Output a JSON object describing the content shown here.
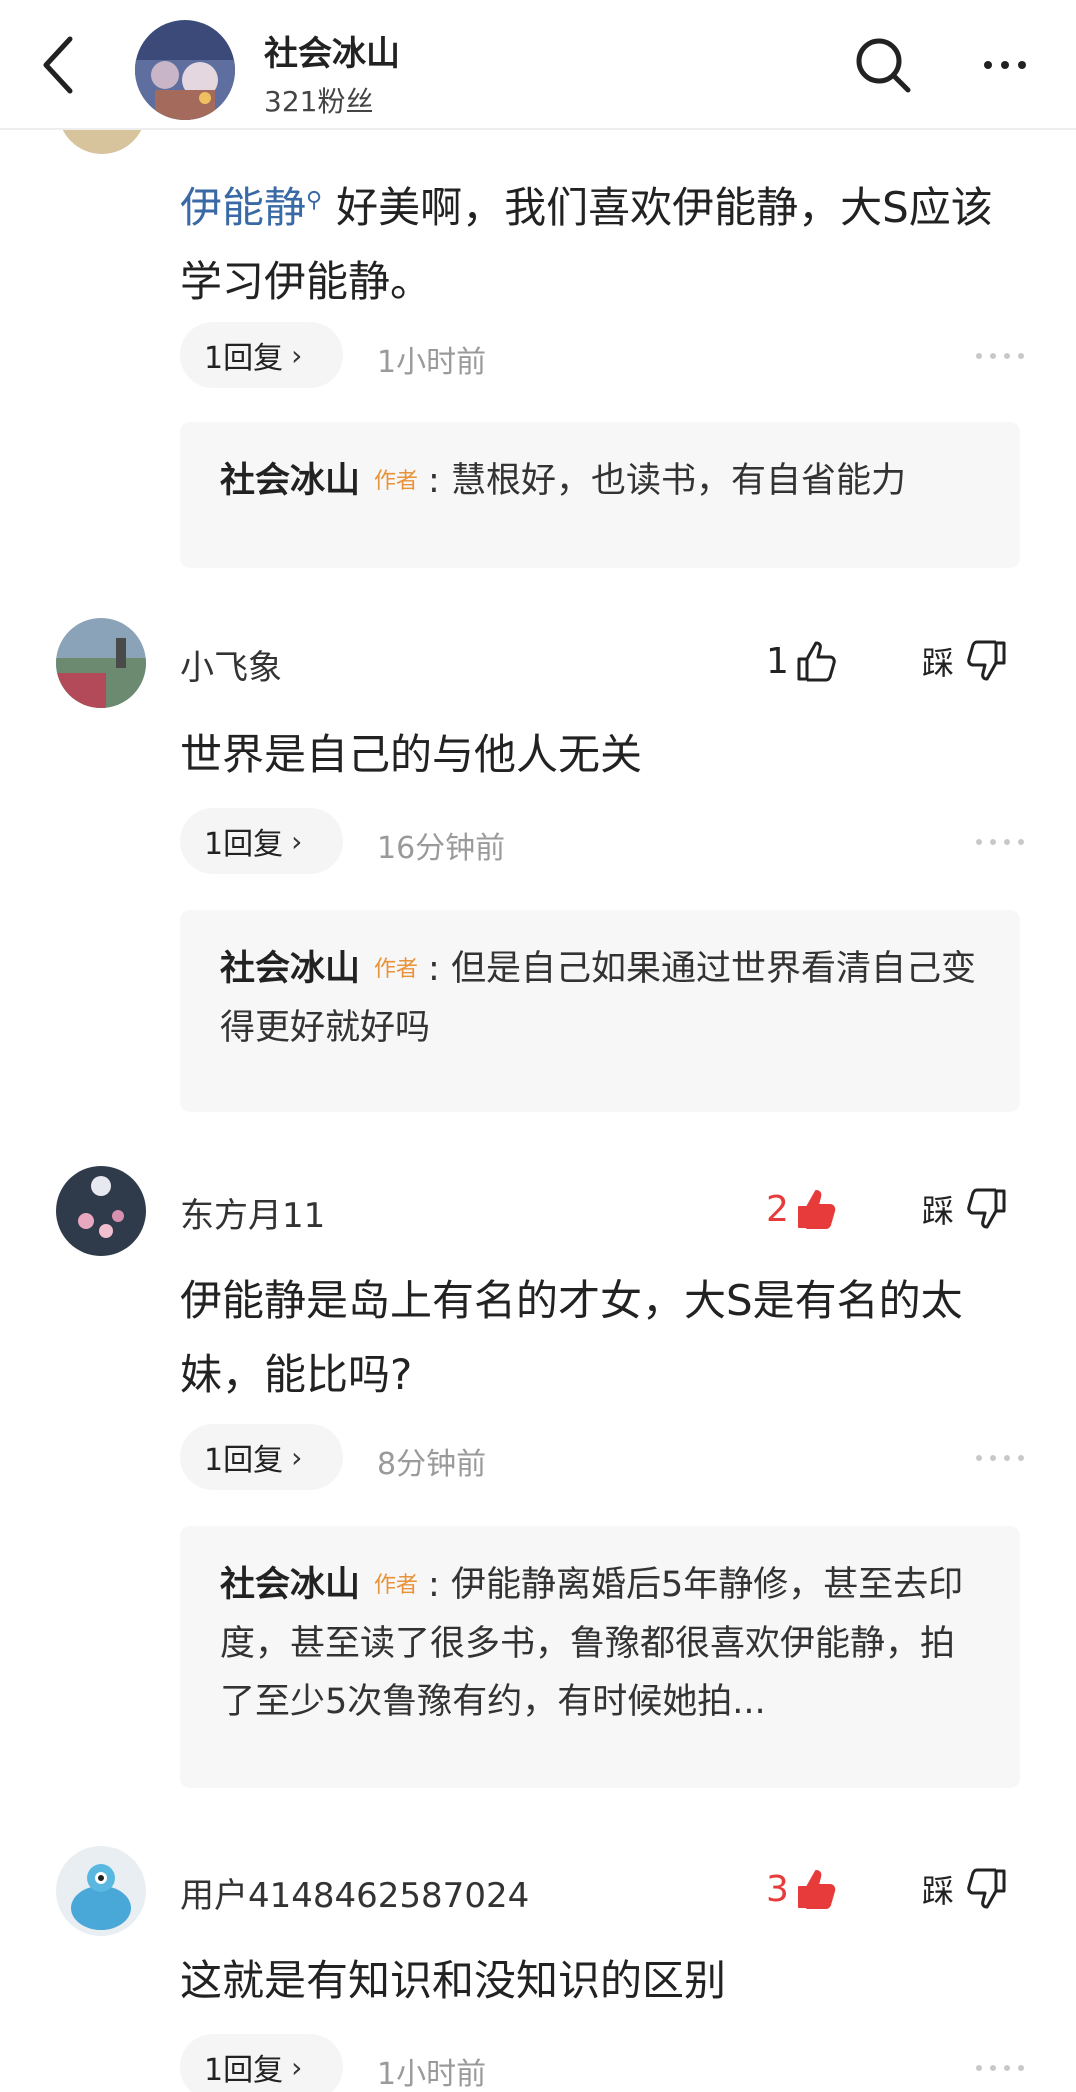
{
  "header": {
    "name": "社会冰山",
    "fans": "321粉丝"
  },
  "first_comment": {
    "mention": "伊能静",
    "text": "好美啊，我们喜欢伊能静，大S应该学习伊能静。",
    "reply_count": "1回复",
    "time": "1小时前",
    "author_reply": {
      "name": "社会冰山",
      "tag": "作者",
      "text": "慧根好，也读书，有自省能力"
    }
  },
  "comments": [
    {
      "name": "小飞象",
      "likes": "1",
      "liked": false,
      "dislike_label": "踩",
      "text": "世界是自己的与他人无关",
      "reply_count": "1回复",
      "time": "16分钟前",
      "author_reply": {
        "name": "社会冰山",
        "tag": "作者",
        "text": "但是自己如果通过世界看清自己变得更好就好吗"
      }
    },
    {
      "name": "东方月11",
      "likes": "2",
      "liked": true,
      "dislike_label": "踩",
      "text": "伊能静是岛上有名的才女，大S是有名的太妹，能比吗?",
      "reply_count": "1回复",
      "time": "8分钟前",
      "author_reply": {
        "name": "社会冰山",
        "tag": "作者",
        "text": "伊能静离婚后5年静修，甚至去印度，甚至读了很多书，鲁豫都很喜欢伊能静，拍了至少5次鲁豫有约，有时候她拍..."
      }
    },
    {
      "name": "用户4148462587024",
      "likes": "3",
      "liked": true,
      "dislike_label": "踩",
      "text": "这就是有知识和没知识的区别",
      "reply_count": "1回复",
      "time": "1小时前"
    }
  ],
  "colors": {
    "accent_red": "#e73b3b",
    "link_blue": "#3a6aa5",
    "author_tag": "#e8923a"
  },
  "icons": [
    "back-arrow-icon",
    "search-icon",
    "more-icon",
    "thumb-up-icon",
    "thumb-down-icon",
    "chevron-right-icon"
  ]
}
